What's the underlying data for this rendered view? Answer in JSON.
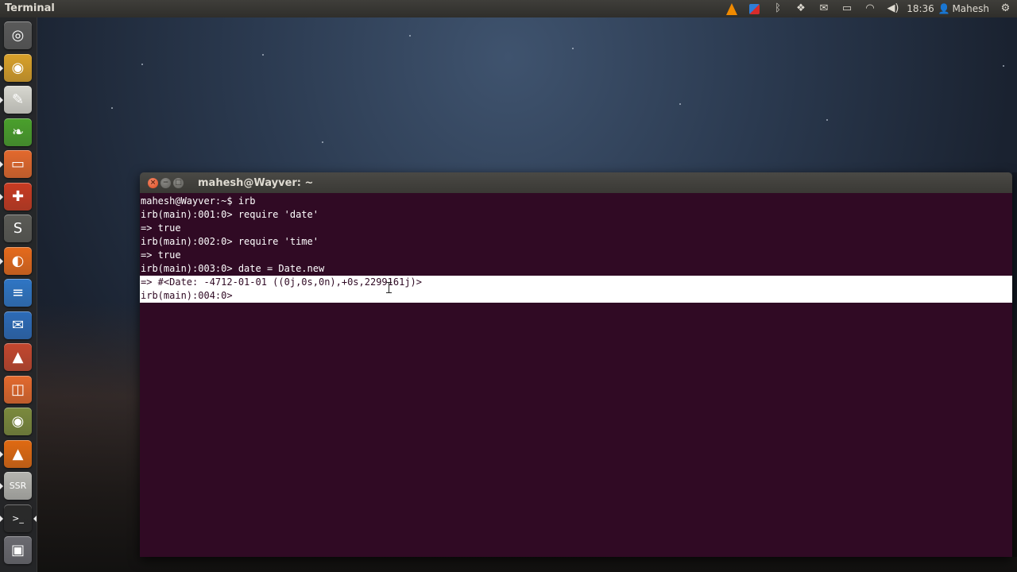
{
  "top_panel": {
    "app_title": "Terminal",
    "clock": "18:36",
    "user": "Mahesh",
    "indicators": [
      "vlc-icon",
      "recorder-icon",
      "bluetooth-icon",
      "dropbox-icon",
      "mail-icon",
      "battery-icon",
      "wifi-icon",
      "volume-icon",
      "user-icon",
      "gear-icon"
    ]
  },
  "launcher": {
    "items": [
      {
        "name": "dash-home",
        "icon": "ubuntu-logo-icon",
        "glyph": "◎",
        "color": "#5a5a5a"
      },
      {
        "name": "chrome",
        "icon": "chrome-icon",
        "glyph": "◉",
        "color": "#d9a12a"
      },
      {
        "name": "text-editor",
        "icon": "text-editor-icon",
        "glyph": "✎",
        "color": "#d8d8d0"
      },
      {
        "name": "gnome-green-app",
        "icon": "leaf-app-icon",
        "glyph": "❧",
        "color": "#4aa02c"
      },
      {
        "name": "files",
        "icon": "folder-icon",
        "glyph": "▭",
        "color": "#e3692d"
      },
      {
        "name": "help",
        "icon": "lifebuoy-icon",
        "glyph": "✚",
        "color": "#c83b22"
      },
      {
        "name": "sublime-text",
        "icon": "sublime-icon",
        "glyph": "S",
        "color": "#5b5b56"
      },
      {
        "name": "firefox",
        "icon": "firefox-icon",
        "glyph": "◐",
        "color": "#e66a1c"
      },
      {
        "name": "libreoffice-writer",
        "icon": "writer-icon",
        "glyph": "≡",
        "color": "#2f76c5"
      },
      {
        "name": "thunderbird",
        "icon": "thunderbird-icon",
        "glyph": "✉",
        "color": "#2c6bb8"
      },
      {
        "name": "inkscape",
        "icon": "inkscape-icon",
        "glyph": "▲",
        "color": "#c3472e"
      },
      {
        "name": "software-center",
        "icon": "shopping-bag-icon",
        "glyph": "◫",
        "color": "#e3692d"
      },
      {
        "name": "webcam",
        "icon": "camera-icon",
        "glyph": "◉",
        "color": "#7b8a3d"
      },
      {
        "name": "vlc",
        "icon": "vlc-icon",
        "glyph": "▲",
        "color": "#e06a12"
      },
      {
        "name": "simplescreenrecorder",
        "icon": "ssr-icon",
        "glyph": "SSR",
        "color": "#b5b5b0"
      },
      {
        "name": "terminal",
        "icon": "terminal-icon",
        "glyph": ">_",
        "color": "#2a2a2a"
      },
      {
        "name": "workspace-switcher",
        "icon": "workspace-icon",
        "glyph": "▣",
        "color": "#6a6a70"
      }
    ]
  },
  "terminal": {
    "window_title": "mahesh@Wayver: ~",
    "buttons": {
      "close": "×",
      "minimize": "−",
      "maximize": "□"
    },
    "lines": [
      "mahesh@Wayver:~$ irb",
      "irb(main):001:0> require 'date'",
      "=> true",
      "irb(main):002:0> require 'time'",
      "=> true",
      "irb(main):003:0> date = Date.new",
      "=> #<Date: -4712-01-01 ((0j,0s,0n),+0s,2299161j)>",
      "irb(main):004:0> "
    ],
    "highlighted_lines": [
      6,
      7
    ]
  }
}
